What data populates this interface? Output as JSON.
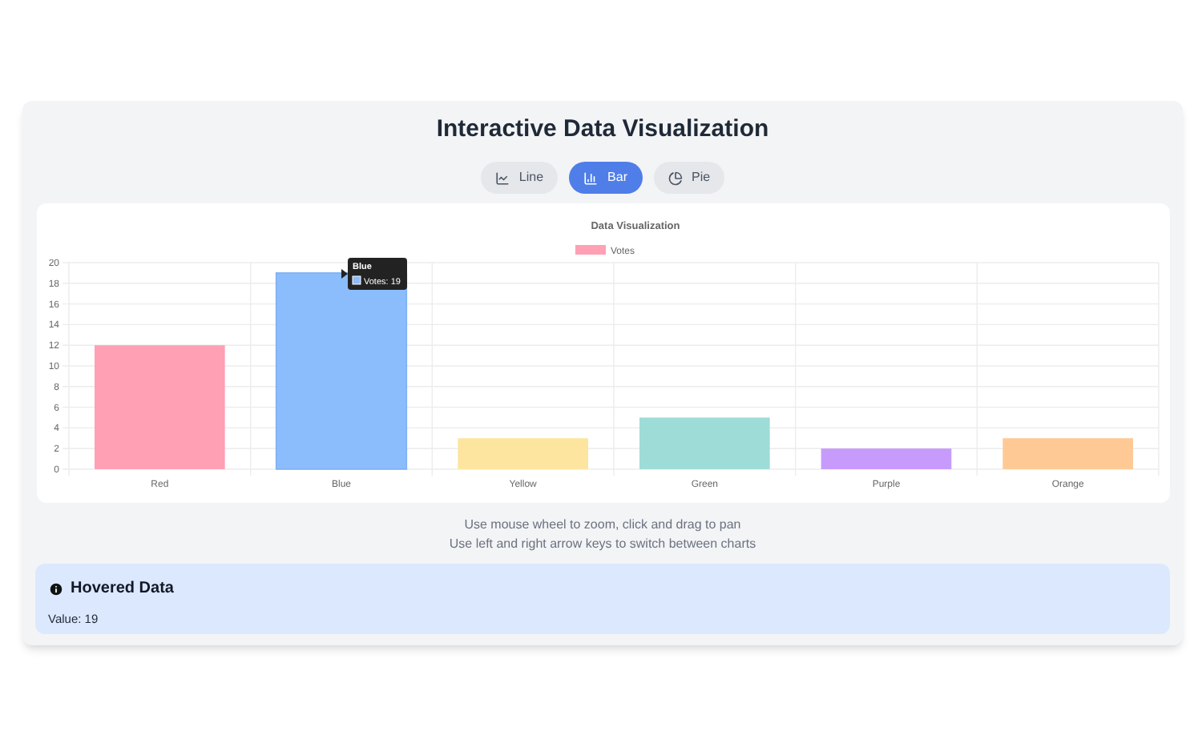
{
  "title": "Interactive Data Visualization",
  "tabs": [
    {
      "label": "Line",
      "kind": "line",
      "selected": false
    },
    {
      "label": "Bar",
      "kind": "bar",
      "selected": true
    },
    {
      "label": "Pie",
      "kind": "pie",
      "selected": false
    }
  ],
  "chart": {
    "chart_data": {
      "type": "bar",
      "title": "Data Visualization",
      "categories": [
        "Red",
        "Blue",
        "Yellow",
        "Green",
        "Purple",
        "Orange"
      ],
      "series": [
        {
          "name": "Votes",
          "values": [
            12,
            19,
            3,
            5,
            2,
            3
          ]
        }
      ],
      "ylim": [
        0,
        20
      ],
      "yticks": [
        0,
        2,
        4,
        6,
        8,
        10,
        12,
        14,
        16,
        18,
        20
      ],
      "grid": true
    },
    "legend": {
      "color": "#ffa0b4"
    },
    "bars": [
      {
        "color": "#ffa0b4",
        "hovered": false
      },
      {
        "color": "#8bbcfb",
        "hovered": true
      },
      {
        "color": "#fde59f",
        "hovered": false
      },
      {
        "color": "#9edcd8",
        "hovered": false
      },
      {
        "color": "#c79bfc",
        "hovered": false
      },
      {
        "color": "#ffc996",
        "hovered": false
      }
    ],
    "tooltip": {
      "title": "Blue",
      "line": "Votes: 19"
    }
  },
  "hints": [
    "Use mouse wheel to zoom, click and drag to pan",
    "Use left and right arrow keys to switch between charts"
  ],
  "hovered": {
    "heading": "Hovered Data",
    "value": "Value: 19"
  }
}
